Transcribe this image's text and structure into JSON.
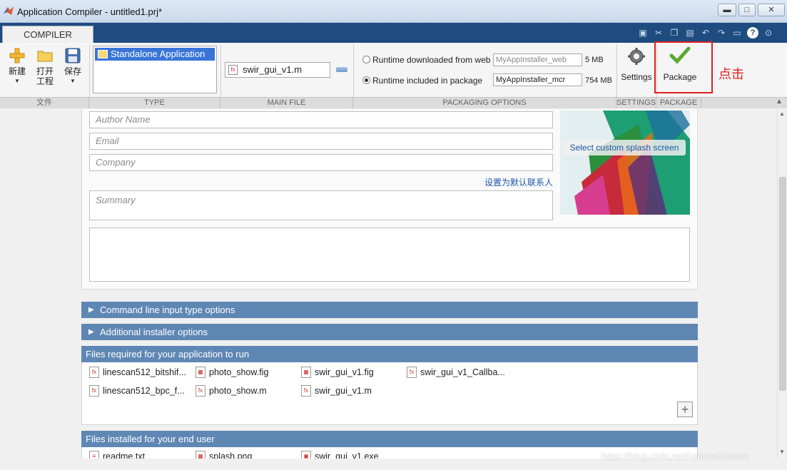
{
  "window": {
    "title": "Application Compiler - untitled1.prj*",
    "min_label": "▬",
    "max_label": "□",
    "close_label": "✕"
  },
  "ribbon": {
    "tab": "COMPILER",
    "qat_icons": [
      "save-icon",
      "cut-icon",
      "copy-icon",
      "paste-icon",
      "undo-icon",
      "redo-icon",
      "switch-window-icon",
      "help-icon",
      "expand-icon"
    ],
    "file_group": {
      "new_label": "新建",
      "open_label_1": "打开",
      "open_label_2": "工程",
      "save_label": "保存",
      "group_label": "文件"
    },
    "type_group": {
      "selected": "Standalone Application",
      "group_label": "TYPE"
    },
    "main_file_group": {
      "file": "swir_gui_v1.m",
      "group_label": "MAIN FILE"
    },
    "packaging_group": {
      "web_label": "Runtime downloaded from web",
      "web_value": "MyAppInstaller_web",
      "web_size": "5 MB",
      "pkg_label": "Runtime included in package",
      "pkg_value": "MyAppInstaller_mcr",
      "pkg_size": "754 MB",
      "selected": "package",
      "group_label": "PACKAGING OPTIONS"
    },
    "settings_group": {
      "label": "Settings",
      "group_label": "SETTINGS"
    },
    "package_group": {
      "label": "Package",
      "group_label": "PACKAGE"
    },
    "annotation": "点击"
  },
  "form": {
    "author_placeholder": "Author Name",
    "email_placeholder": "Email",
    "company_placeholder": "Company",
    "default_contact_link": "设置为默认联系人",
    "summary_placeholder": "Summary",
    "splash_button": "Select custom splash screen"
  },
  "sections": {
    "cmdline": "Command line input type options",
    "installer": "Additional installer options",
    "required_header": "Files required for your application to run",
    "installed_header": "Files installed for your end user"
  },
  "required_files": [
    "linescan512_bitshif...",
    "photo_show.fig",
    "swir_gui_v1.fig",
    "swir_gui_v1_Callba...",
    "linescan512_bpc_f...",
    "photo_show.m",
    "swir_gui_v1.m"
  ],
  "installed_files": [
    "readme.txt",
    "splash.png",
    "swir_gui_v1.exe"
  ],
  "watermark": "https://blog.csdn.net/hahahahhahha"
}
